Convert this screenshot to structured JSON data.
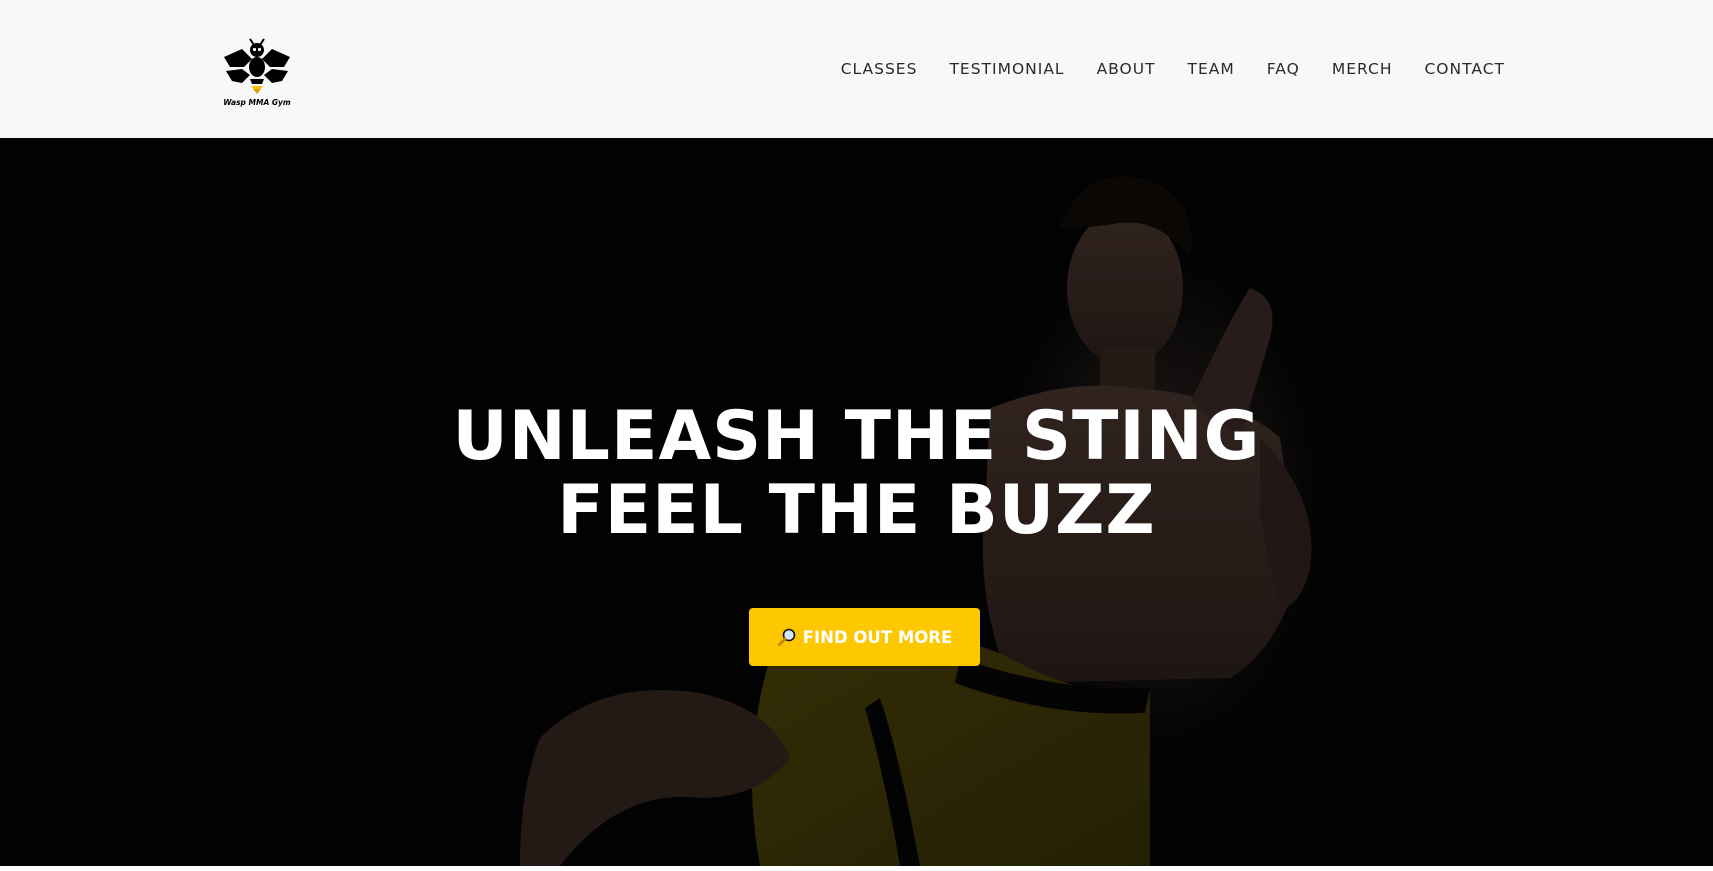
{
  "brand": {
    "name": "Wasp MMA Gym",
    "logo_icon": "wasp-logo-icon",
    "accent": "#f5c400"
  },
  "nav": {
    "items": [
      {
        "label": "CLASSES"
      },
      {
        "label": "TESTIMONIAL"
      },
      {
        "label": "ABOUT"
      },
      {
        "label": "TEAM"
      },
      {
        "label": "FAQ"
      },
      {
        "label": "MERCH"
      },
      {
        "label": "CONTACT"
      }
    ]
  },
  "hero": {
    "heading_line1": "UNLEASH THE STING",
    "heading_line2": "FEEL THE BUZZ",
    "cta_icon": "magnifying-glass-icon",
    "cta_label": "FIND OUT MORE",
    "cta_color": "#fdc800",
    "background": "fighter-photo"
  }
}
